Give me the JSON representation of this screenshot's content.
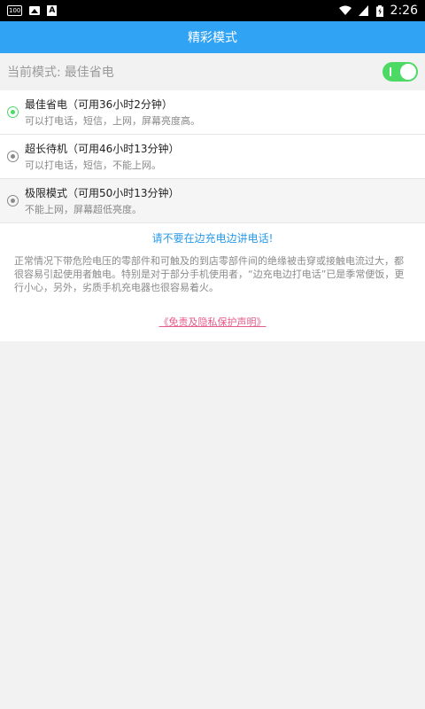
{
  "statusbar": {
    "left_icons": [
      "100",
      "image-icon",
      "A"
    ],
    "time": "2:26"
  },
  "appbar": {
    "title": "精彩模式"
  },
  "current_mode": {
    "label": "当前模式:",
    "value": "最佳省电",
    "toggle_on": true
  },
  "modes": [
    {
      "title": "最佳省电（可用36小时2分钟）",
      "desc": "可以打电话，短信，上网，屏幕亮度高。",
      "selected": true
    },
    {
      "title": "超长待机（可用46小时13分钟）",
      "desc": "可以打电话，短信，不能上网。",
      "selected": false
    },
    {
      "title": "极限模式（可用50小时13分钟）",
      "desc": "不能上网，屏幕超低亮度。",
      "selected": false
    }
  ],
  "notice": {
    "title": "请不要在边充电边讲电话!",
    "body": "正常情况下带危险电压的零部件和可触及的到店零部件间的绝缘被击穿或接触电流过大，都很容易引起使用者触电。特别是对于部分手机使用者，“边充电边打电话”已是季常便饭，更行小心，另外，劣质手机充电器也很容易着火。",
    "disclaimer": "《免责及隐私保护声明》"
  },
  "colors": {
    "appbar": "#31a3f5",
    "toggle": "#4cd964",
    "notice_title": "#2a9bea",
    "disclaimer": "#e65b8a"
  }
}
